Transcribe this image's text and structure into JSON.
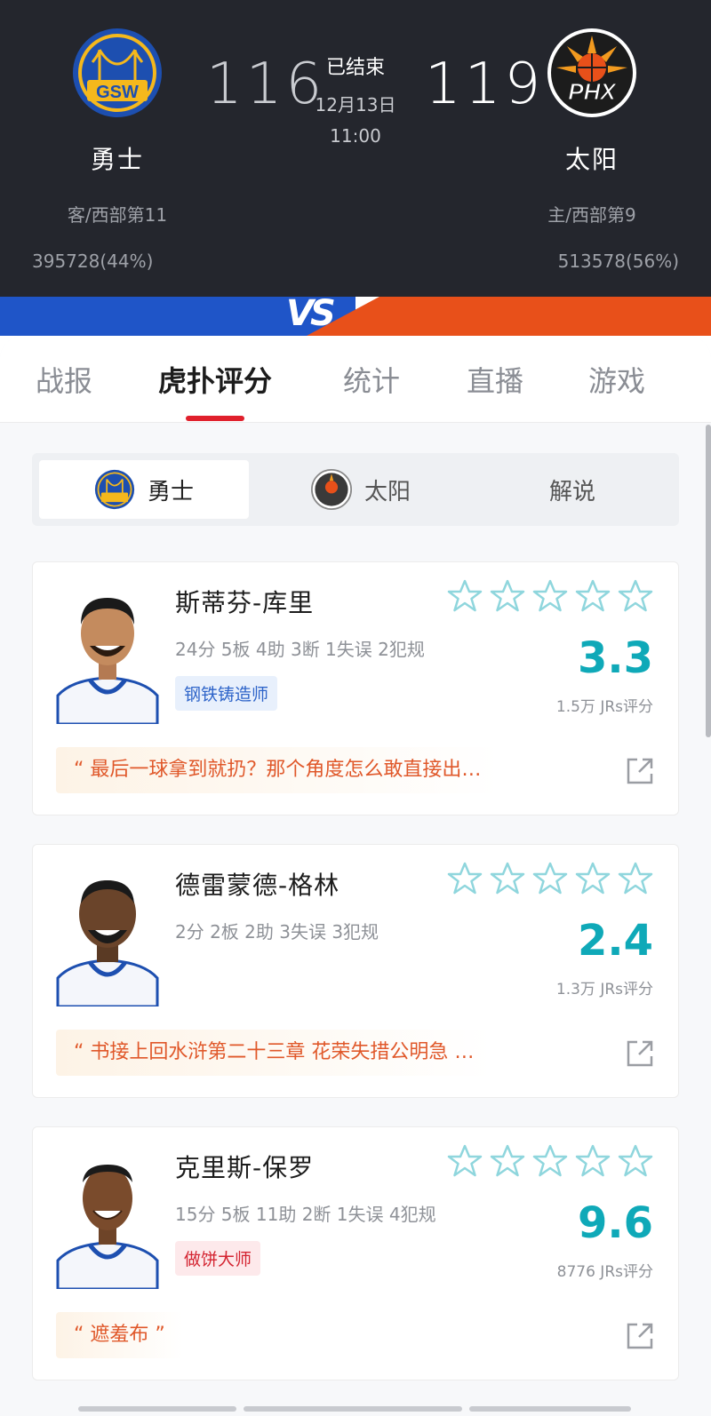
{
  "game": {
    "status": "已结束",
    "date": "12月13日",
    "time": "11:00",
    "away": {
      "name": "勇士",
      "abbr": "GSW",
      "score": "116",
      "rank": "客/西部第11",
      "support": "395728(44%)",
      "color": "#1f55c8"
    },
    "home": {
      "name": "太阳",
      "abbr": "PHX",
      "score": "119",
      "rank": "主/西部第9",
      "support": "513578(56%)",
      "color": "#e8501a"
    },
    "vs_label": "VS"
  },
  "tabs": [
    {
      "label": "战报"
    },
    {
      "label": "虎扑评分"
    },
    {
      "label": "统计"
    },
    {
      "label": "直播"
    },
    {
      "label": "游戏"
    }
  ],
  "segments": [
    {
      "label": "勇士"
    },
    {
      "label": "太阳"
    },
    {
      "label": "解说"
    }
  ],
  "players": [
    {
      "name": "斯蒂芬-库里",
      "stats": "24分 5板 4助 3断 1失误 2犯规",
      "tag": "钢铁铸造师",
      "tag_style": "blue",
      "score": "3.3",
      "raters": "1.5万 JRs评分",
      "quote": "“ 最后一球拿到就扔？那个角度怎么敢直接出…"
    },
    {
      "name": "德雷蒙德-格林",
      "stats": "2分 2板 2助 3失误 3犯规",
      "tag": "",
      "tag_style": "",
      "score": "2.4",
      "raters": "1.3万 JRs评分",
      "quote": "“ 书接上回水浒第二十三章 花荣失措公明急 …"
    },
    {
      "name": "克里斯-保罗",
      "stats": "15分 5板 11助 2断 1失误 4犯规",
      "tag": "做饼大师",
      "tag_style": "red",
      "score": "9.6",
      "raters": "8776 JRs评分",
      "quote": "“ 遮羞布 ”"
    }
  ],
  "colors": {
    "accent_red": "#e0202c",
    "score_teal": "#0fa9b8",
    "quote_orange": "#e0582a"
  }
}
